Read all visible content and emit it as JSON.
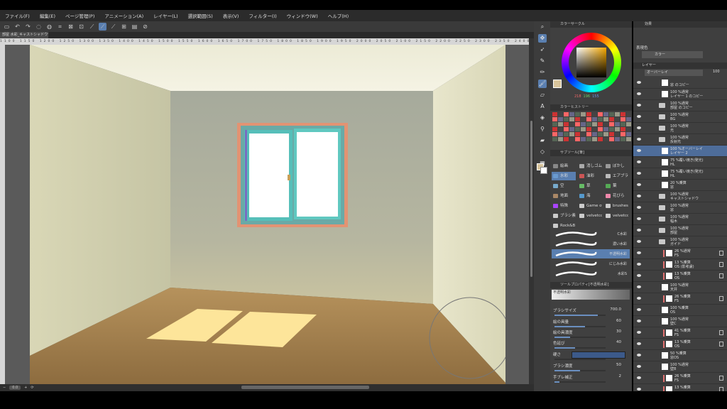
{
  "menu": [
    "ファイル(F)",
    "編集(E)",
    "ページ管理(P)",
    "アニメーション(A)",
    "レイヤー(L)",
    "選択範囲(S)",
    "表示(V)",
    "フィルター(I)",
    "ウィンドウ(W)",
    "ヘルプ(H)"
  ],
  "document_tab": "部屋 水彩_キャストシャドウ* ×",
  "ruler_text": "1100 1150 1200 1250 1300 1350 1400 1450 1500 1550 1600 1650 1700 1750 1800 1850 1900 1950 2000 2050 2100 2150 2200 2250 2300 2350 2400 2450 2500 2550 2600 2650 2700 2750",
  "status": {
    "zoom": "0.0"
  },
  "color_panel": {
    "title": "カラーサークル",
    "r": "218",
    "g": "196",
    "b": "155",
    "main_color": "#d8c49b"
  },
  "history_panel": {
    "title": "カラーヒストリー"
  },
  "subtool_panel": {
    "title": "サブツール[筆]",
    "tabs": [
      "絵画",
      "消しゴム",
      "ぼかし",
      "水彩",
      "油彩",
      "エアブラシ",
      "空",
      "草",
      "葉",
      "地面",
      "海",
      "花びら",
      "特殊",
      "Game of",
      "brushes",
      "ブラシ素材",
      "velvetco",
      "velvetco",
      "Rock&B"
    ],
    "brushes": [
      "C水彩",
      "濃い水彩",
      "不透明水彩",
      "にじみ水彩",
      "水彩S"
    ]
  },
  "property_panel": {
    "title": "ツールプロパティ[不透明水彩]",
    "preview_label": "不透明水彩",
    "rows": [
      {
        "label": "ブラシサイズ",
        "value": "700.0",
        "level": 0.85
      },
      {
        "label": "絵の具量",
        "value": "60",
        "level": 0.6
      },
      {
        "label": "絵の具濃度",
        "value": "30",
        "level": 0.3
      },
      {
        "label": "色延び",
        "value": "40",
        "level": 0.4
      },
      {
        "label": "硬さ",
        "value": "",
        "level": 0
      },
      {
        "label": "ブラシ濃度",
        "value": "50",
        "level": 0.5
      },
      {
        "label": "手ブレ補正",
        "value": "2",
        "level": 0.1
      }
    ]
  },
  "layer_panel": {
    "title": "レイヤー",
    "effect_label": "効果",
    "display_color_label": "表現色",
    "color_mode": "カラー",
    "blend_mode": "オーバーレイ",
    "opacity": "100",
    "layers": [
      {
        "pct": "",
        "name": "窓 のコピー",
        "kind": "thumb"
      },
      {
        "pct": "100 %通常",
        "name": "レイヤー 1 のコピー",
        "kind": "thumb"
      },
      {
        "pct": "100 %通常",
        "name": "部屋 のコピー",
        "kind": "folder"
      },
      {
        "pct": "100 %通常",
        "name": "BG",
        "kind": "folder"
      },
      {
        "pct": "100 %通常",
        "name": "光",
        "kind": "folder"
      },
      {
        "pct": "100 %通常",
        "name": "反射光",
        "kind": "folder"
      },
      {
        "pct": "100 %オーバーレイ",
        "name": "レイヤー 2",
        "kind": "thumb",
        "selected": true
      },
      {
        "pct": "75 %覆い焼き(発光)",
        "name": "HL",
        "kind": "thumb"
      },
      {
        "pct": "75 %覆い焼き(発光)",
        "name": "HL",
        "kind": "thumb"
      },
      {
        "pct": "20 %乗算",
        "name": "窓",
        "kind": "thumb"
      },
      {
        "pct": "100 %通常",
        "name": "キャストシャドウ",
        "kind": "folder"
      },
      {
        "pct": "100 %通常",
        "name": "窓",
        "kind": "folder"
      },
      {
        "pct": "100 %通常",
        "name": "幅木",
        "kind": "folder"
      },
      {
        "pct": "100 %通常",
        "name": "部屋",
        "kind": "folder"
      },
      {
        "pct": "100 %通常",
        "name": "ガイド",
        "kind": "folder"
      },
      {
        "pct": "26 %通常",
        "name": "FS",
        "kind": "mark"
      },
      {
        "pct": "13 %乗算",
        "name": "OS (影考慮)",
        "kind": "mark"
      },
      {
        "pct": "13 %乗算",
        "name": "OS",
        "kind": "mark"
      },
      {
        "pct": "100 %通常",
        "name": "天井",
        "kind": "thumb"
      },
      {
        "pct": "26 %乗算",
        "name": "FS",
        "kind": "mark"
      },
      {
        "pct": "100 %乗算",
        "name": "OS",
        "kind": "thumb"
      },
      {
        "pct": "100 %通常",
        "name": "壁C",
        "kind": "thumb"
      },
      {
        "pct": "41 %乗算",
        "name": "FS",
        "kind": "mark"
      },
      {
        "pct": "13 %乗算",
        "name": "OS",
        "kind": "mark"
      },
      {
        "pct": "50 %乗算",
        "name": "窓OS",
        "kind": "thumb"
      },
      {
        "pct": "100 %通常",
        "name": "壁B",
        "kind": "thumb"
      },
      {
        "pct": "26 %乗算",
        "name": "FS",
        "kind": "mark"
      },
      {
        "pct": "13 %乗算",
        "name": "",
        "kind": "mark"
      }
    ]
  }
}
